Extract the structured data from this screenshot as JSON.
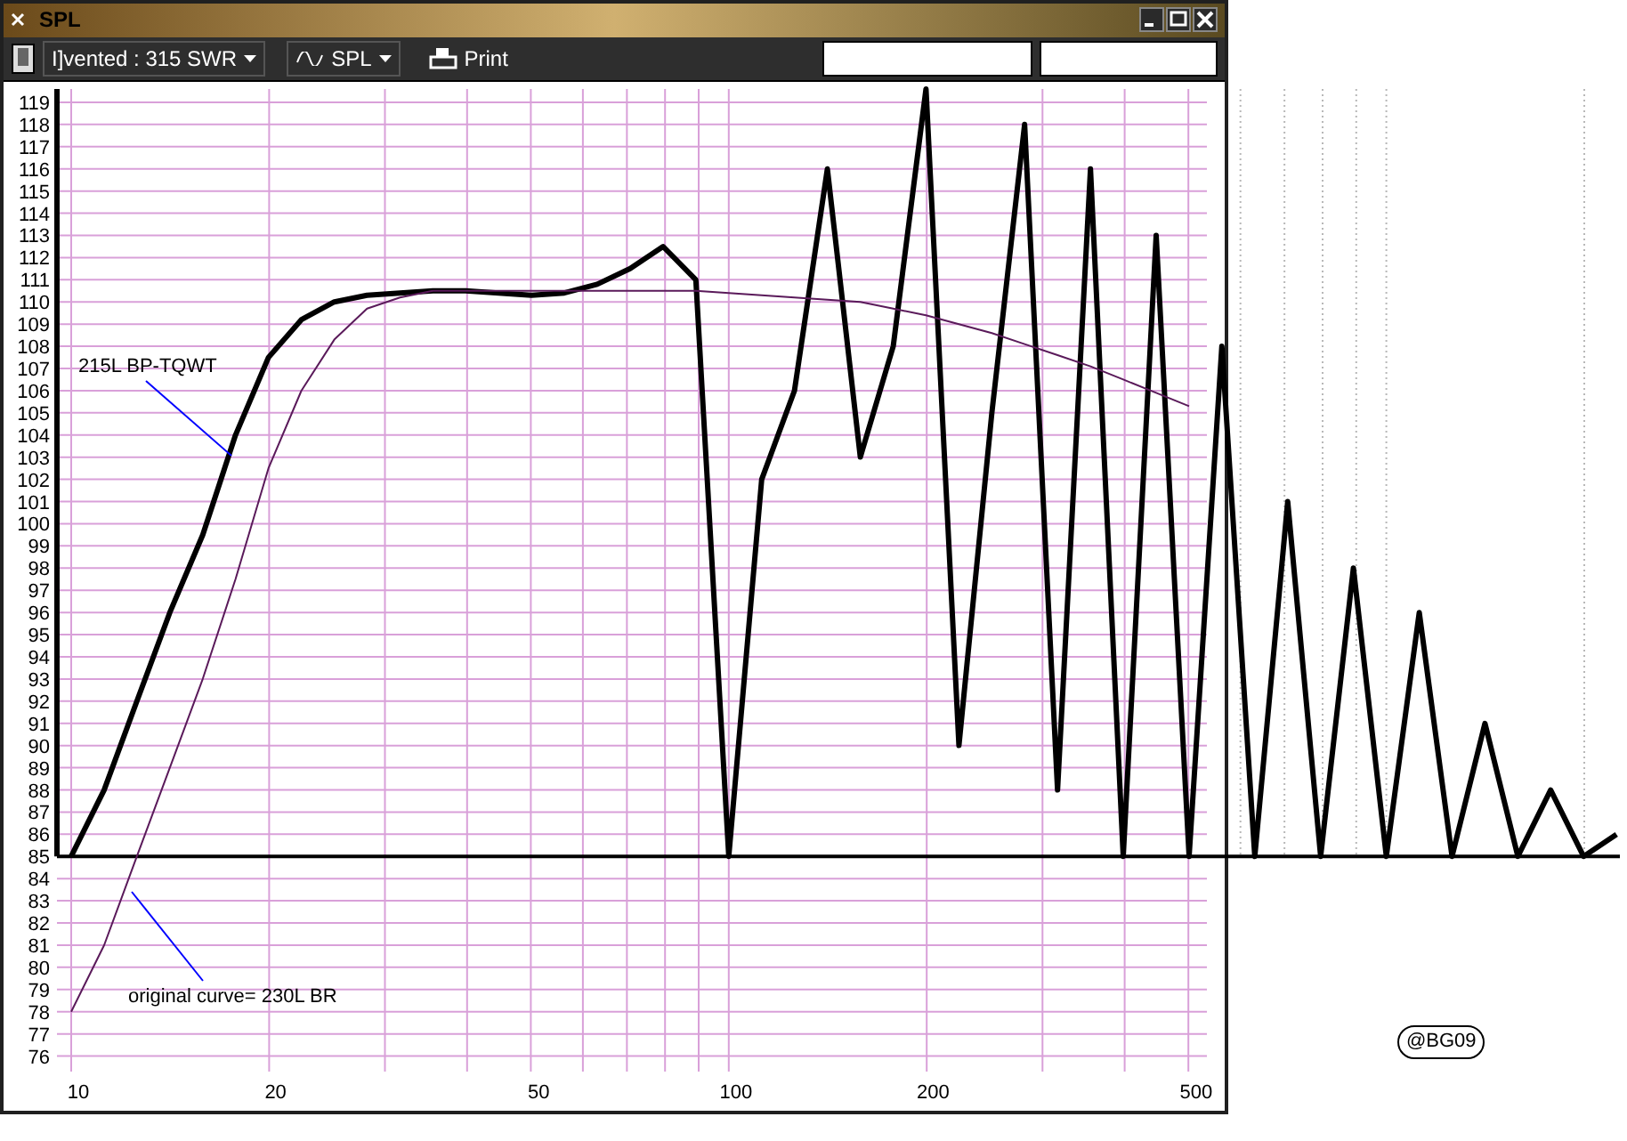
{
  "window": {
    "title": "SPL"
  },
  "toolbar": {
    "design_dropdown": "I]vented : 315 SWR",
    "view_dropdown": "SPL",
    "print_button": "Print"
  },
  "chart": {
    "chart_data": {
      "type": "line",
      "categories": [
        "10",
        null,
        null,
        null,
        null,
        null,
        "20",
        null,
        null,
        null,
        null,
        null,
        null,
        null,
        "50",
        null,
        null,
        null,
        null,
        null,
        "100",
        null,
        null,
        null,
        null,
        null,
        "200",
        null,
        null,
        null,
        null,
        null,
        null,
        null,
        "500",
        null,
        null,
        null,
        null,
        null,
        null,
        null,
        null,
        null,
        null,
        null,
        null,
        null
      ],
      "series": [
        {
          "name": "215L BP-TQWT",
          "color": "#000000",
          "values": [
            85,
            88,
            92,
            96,
            99.5,
            104,
            107.5,
            109.2,
            110,
            110.3,
            110.4,
            110.5,
            110.5,
            110.4,
            110.3,
            110.4,
            110.8,
            111.5,
            112.5,
            111,
            85,
            102,
            106,
            116,
            103,
            108,
            119.6,
            90,
            105,
            118,
            88,
            116,
            85,
            113,
            85,
            108,
            85,
            101,
            85,
            98,
            85,
            96,
            85,
            91,
            85,
            88,
            85,
            86
          ]
        },
        {
          "name": "original curve= 230L BR",
          "color": "#5a1a5a",
          "values": [
            78,
            81,
            85,
            89,
            93,
            97.5,
            102.5,
            106,
            108.3,
            109.7,
            110.2,
            110.5,
            110.5,
            110.5,
            110.5,
            110.5,
            110.5,
            110.5,
            110.5,
            110.5,
            110.4,
            110.3,
            110.2,
            110.1,
            110,
            109.7,
            109.4,
            109,
            108.6,
            108.1,
            107.6,
            107.1,
            106.5,
            105.9,
            105.3,
            null,
            null,
            null,
            null,
            null,
            null,
            null,
            null,
            null,
            null,
            null,
            null,
            null
          ]
        }
      ],
      "ylim": [
        75.3,
        119.6
      ],
      "grid": true,
      "ref_lines": [
        {
          "axis": "y",
          "value": 85
        }
      ],
      "yticks": [
        76,
        77,
        78,
        79,
        80,
        81,
        82,
        83,
        84,
        85,
        86,
        87,
        88,
        89,
        90,
        91,
        92,
        93,
        94,
        95,
        96,
        97,
        98,
        99,
        100,
        101,
        102,
        103,
        104,
        105,
        106,
        107,
        108,
        109,
        110,
        111,
        112,
        113,
        114,
        115,
        116,
        117,
        118,
        119
      ]
    }
  },
  "signature": "@BG09"
}
